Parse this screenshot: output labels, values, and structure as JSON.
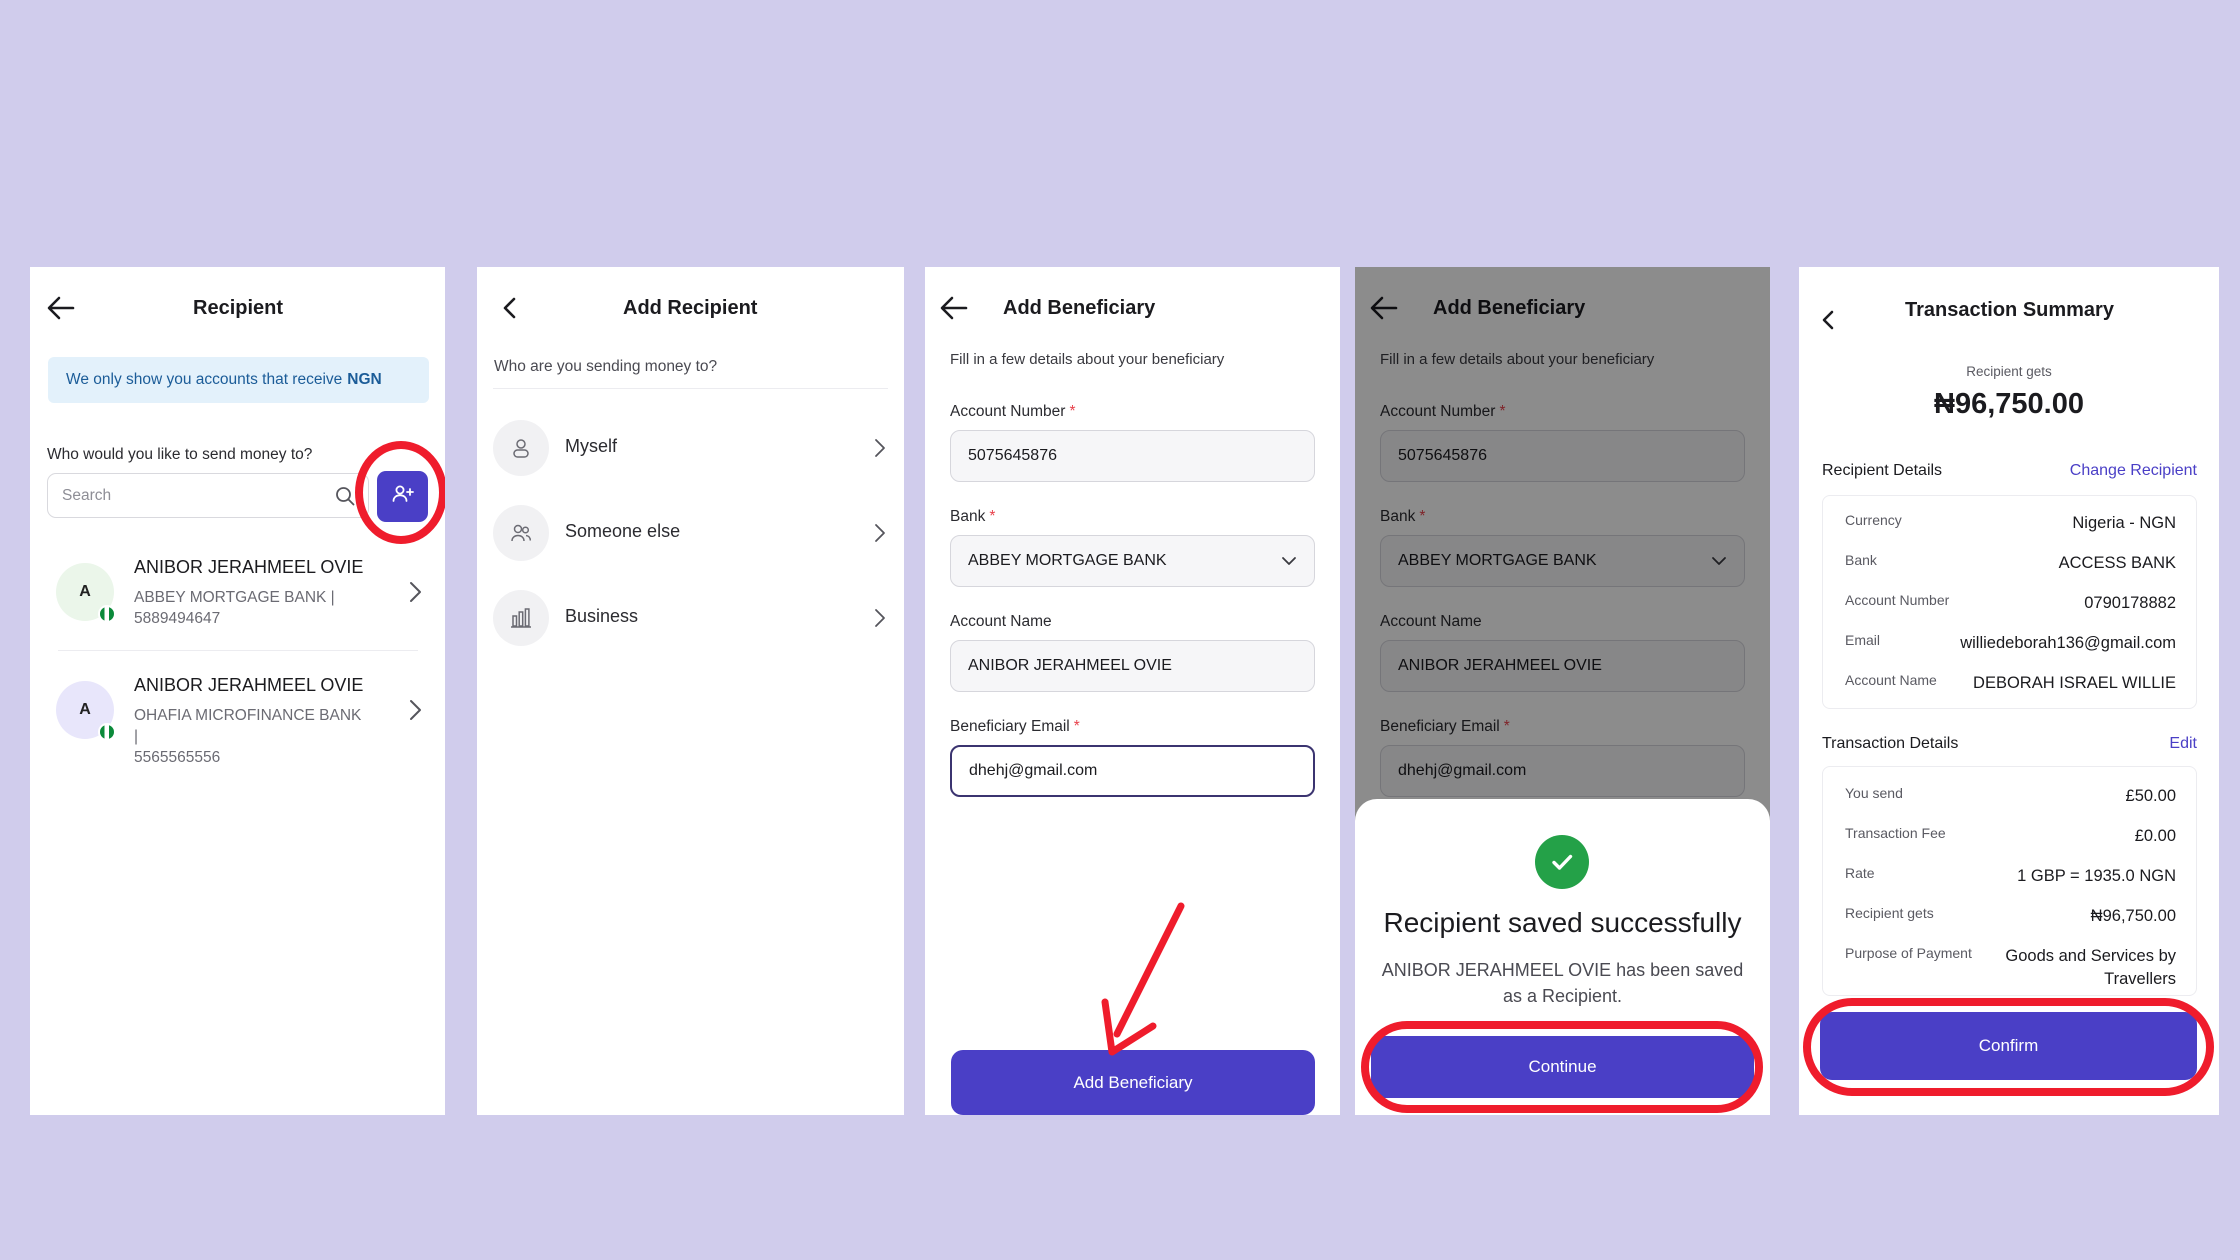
{
  "colors": {
    "background": "#d0ccec",
    "accent": "#4a3fc6",
    "highlight_ring": "#ef1c2c",
    "success": "#24a148",
    "link": "#4a3fc6"
  },
  "screen1": {
    "title": "Recipient",
    "banner_text": "We only show you accounts that receive",
    "banner_currency": "NGN",
    "prompt": "Who would you like to send money to?",
    "search_placeholder": "Search",
    "icons": {
      "back": "arrow-left-icon",
      "search": "search-icon",
      "add": "add-user-icon",
      "chevron": "chevron-right-icon"
    },
    "recipients": [
      {
        "initial": "A",
        "name": "ANIBOR JERAHMEEL OVIE",
        "bank": "ABBEY MORTGAGE BANK |",
        "account": "5889494647",
        "avatar_color": "#ebf6ea"
      },
      {
        "initial": "A",
        "name": "ANIBOR JERAHMEEL OVIE",
        "bank": "OHAFIA MICROFINANCE BANK |",
        "account": "5565565556",
        "avatar_color": "#e8e6fb"
      }
    ]
  },
  "screen2": {
    "title": "Add Recipient",
    "question": "Who are you sending money to?",
    "options": [
      {
        "label": "Myself",
        "icon": "user-icon"
      },
      {
        "label": "Someone else",
        "icon": "users-icon"
      },
      {
        "label": "Business",
        "icon": "chart-icon"
      }
    ]
  },
  "screen3": {
    "title": "Add Beneficiary",
    "subtitle": "Fill in a few details about your beneficiary",
    "account_number_label": "Account Number",
    "account_number": "5075645876",
    "bank_label": "Bank",
    "bank": "ABBEY MORTGAGE BANK",
    "account_name_label": "Account Name",
    "account_name": "ANIBOR JERAHMEEL OVIE",
    "email_label": "Beneficiary Email",
    "email": "dhehj@gmail.com",
    "required_mark": "*",
    "submit_label": "Add Beneficiary"
  },
  "screen4": {
    "title": "Add Beneficiary",
    "subtitle": "Fill in a few details about your beneficiary",
    "account_number_label": "Account Number",
    "account_number": "5075645876",
    "bank_label": "Bank",
    "bank": "ABBEY MORTGAGE BANK",
    "account_name_label": "Account Name",
    "account_name": "ANIBOR JERAHMEEL OVIE",
    "email_label": "Beneficiary Email",
    "email": "dhehj@gmail.com",
    "required_mark": "*",
    "success_title": "Recipient saved successfully",
    "success_desc": "ANIBOR JERAHMEEL OVIE has been saved as a Recipient.",
    "continue_label": "Continue"
  },
  "screen5": {
    "title": "Transaction Summary",
    "recipient_gets_label": "Recipient gets",
    "amount": "₦96,750.00",
    "recipient_section": "Recipient Details",
    "change_recipient": "Change Recipient",
    "recipient_details": [
      {
        "k": "Currency",
        "v": "Nigeria - NGN"
      },
      {
        "k": "Bank",
        "v": "ACCESS BANK"
      },
      {
        "k": "Account Number",
        "v": "0790178882"
      },
      {
        "k": "Email",
        "v": "williedeborah136@gmail.com"
      },
      {
        "k": "Account Name",
        "v": "DEBORAH ISRAEL WILLIE"
      }
    ],
    "transaction_section": "Transaction Details",
    "edit_label": "Edit",
    "transaction_details": [
      {
        "k": "You send",
        "v": "£50.00"
      },
      {
        "k": "Transaction Fee",
        "v": "£0.00"
      },
      {
        "k": "Rate",
        "v": "1 GBP = 1935.0 NGN"
      },
      {
        "k": "Recipient gets",
        "v": "₦96,750.00"
      },
      {
        "k": "Purpose of Payment",
        "v": "Goods and Services by Travellers"
      }
    ],
    "confirm_label": "Confirm"
  }
}
